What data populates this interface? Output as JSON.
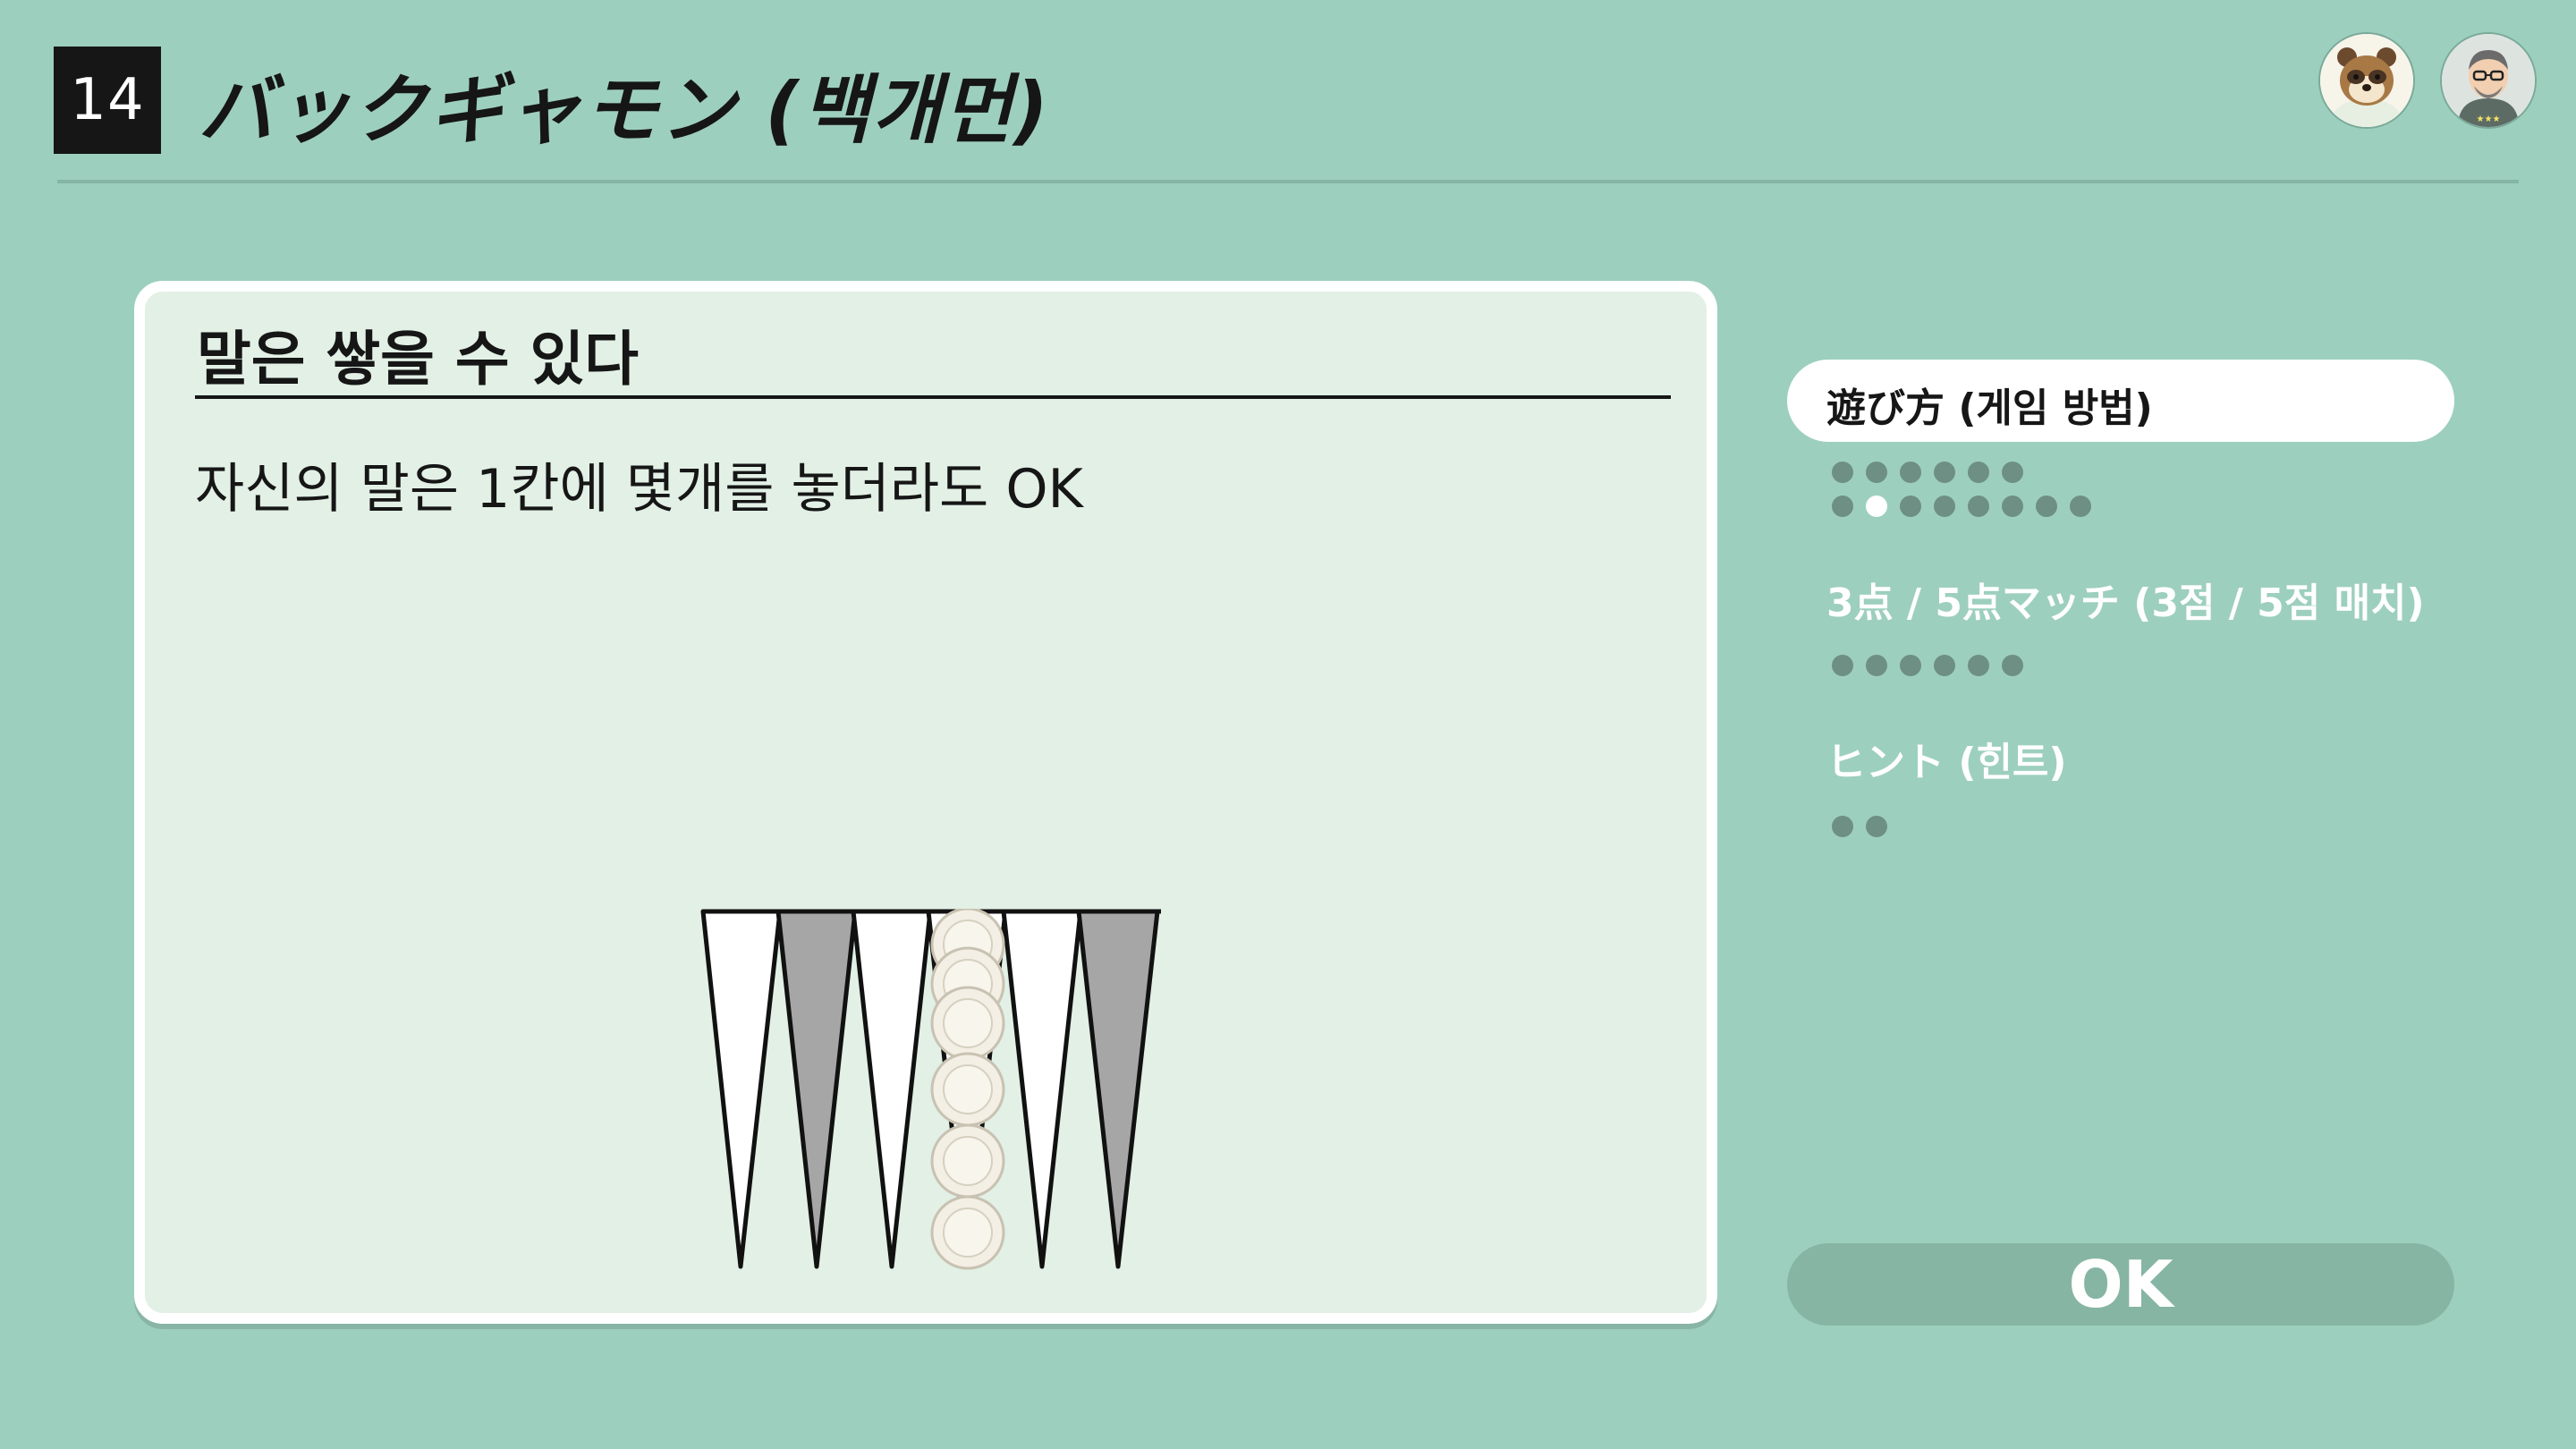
{
  "header": {
    "number": "14",
    "title": "バックギャモン (백개먼)"
  },
  "avatars": [
    {
      "name": "tanuki-avatar"
    },
    {
      "name": "player-avatar"
    }
  ],
  "card": {
    "heading": "말은 쌓을 수 있다",
    "body": "자신의 말은 1칸에 몇개를 놓더라도 OK",
    "illustration": {
      "points": 6,
      "point_colors": [
        "white",
        "gray",
        "white",
        "white",
        "white",
        "gray"
      ],
      "stacked_checkers": 6,
      "checker_color": "#f3efe4",
      "dark_point_color": "#a6a6a6"
    }
  },
  "menu": {
    "sections": [
      {
        "label": "遊び方 (게임 방법)",
        "active": true,
        "dot_rows": [
          6,
          8
        ],
        "current_dot": {
          "row": 1,
          "index": 1
        }
      },
      {
        "label": "3点 / 5点マッチ (3점 / 5점 매치)",
        "active": false,
        "dot_rows": [
          6
        ]
      },
      {
        "label": "ヒント (힌트)",
        "active": false,
        "dot_rows": [
          2
        ]
      }
    ]
  },
  "ok_button": {
    "label": "OK"
  },
  "colors": {
    "background": "#9dcfbe",
    "card": "#e2f0e6",
    "dot": "#6e8f84",
    "ok_button": "#86b5a4"
  }
}
